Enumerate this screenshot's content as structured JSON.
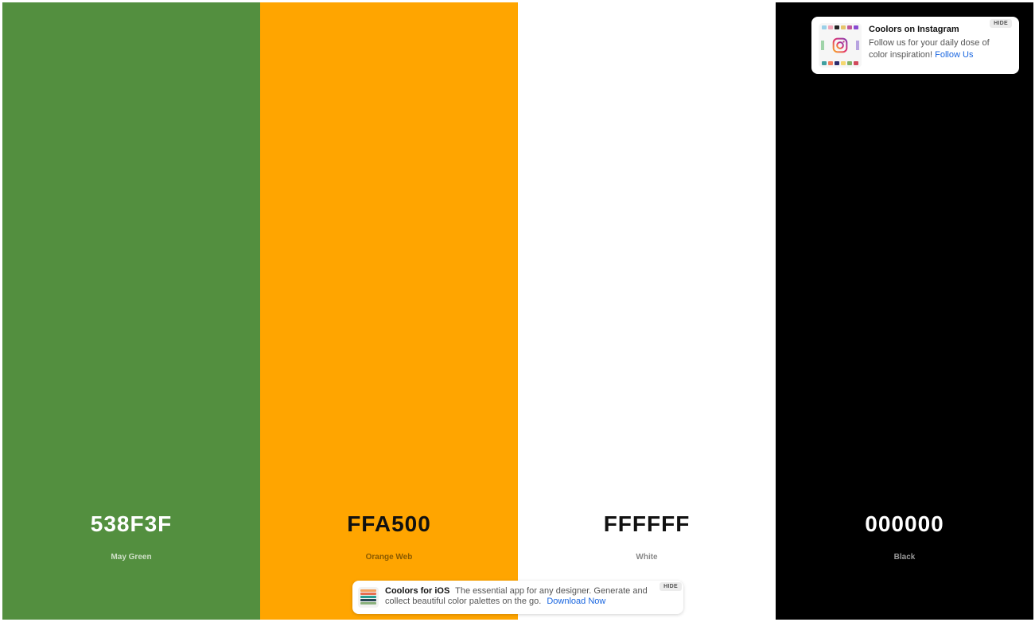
{
  "palette": {
    "swatches": [
      {
        "hex": "538F3F",
        "name": "May Green",
        "bg": "#538F3F",
        "hex_color": "#ffffff",
        "name_color": "#cfe0c8"
      },
      {
        "hex": "FFA500",
        "name": "Orange Web",
        "bg": "#FFA500",
        "hex_color": "#111111",
        "name_color": "#8a5a00"
      },
      {
        "hex": "FFFFFF",
        "name": "White",
        "bg": "#FFFFFF",
        "hex_color": "#111111",
        "name_color": "#8a8a8a"
      },
      {
        "hex": "000000",
        "name": "Black",
        "bg": "#000000",
        "hex_color": "#ffffff",
        "name_color": "#9a9a9a"
      }
    ]
  },
  "instagram_card": {
    "title": "Coolors on Instagram",
    "text": "Follow us for your daily dose of color inspiration!",
    "link": "Follow Us",
    "hide_label": "HIDE",
    "icon": "instagram-icon"
  },
  "ios_banner": {
    "title": "Coolors for iOS",
    "text": "The essential app for any designer. Generate and collect beautiful color palettes on the go.",
    "link": "Download Now",
    "hide_label": "HIDE",
    "icon": "app-icon"
  }
}
